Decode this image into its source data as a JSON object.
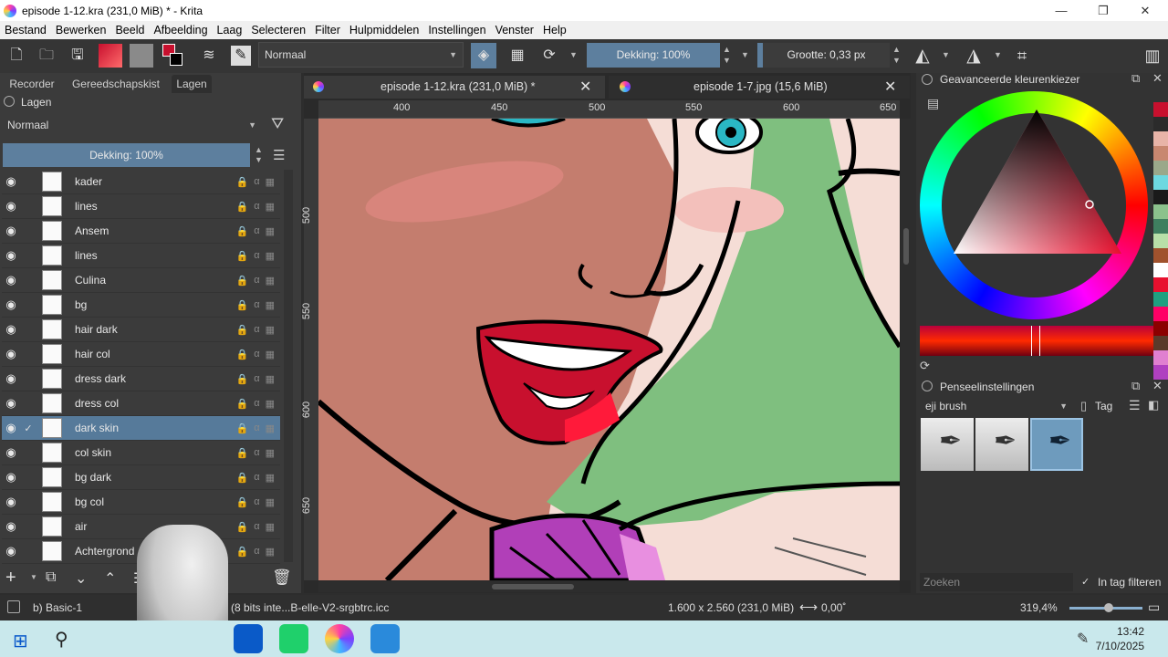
{
  "window": {
    "title": "episode 1-12.kra (231,0 MiB) * - Krita",
    "minimize": "—",
    "restore": "❐",
    "close": "✕"
  },
  "menu": [
    "Bestand",
    "Bewerken",
    "Beeld",
    "Afbeelding",
    "Laag",
    "Selecteren",
    "Filter",
    "Hulpmiddelen",
    "Instellingen",
    "Venster",
    "Help"
  ],
  "toolbar": {
    "blend_mode": "Normaal",
    "opacity": "Dekking: 100%",
    "size": "Grootte: 0,33 px"
  },
  "left_tabs": [
    "Recorder",
    "Gereedschapskist",
    "Lagen"
  ],
  "layers_panel": {
    "title": "Lagen",
    "blend_mode": "Normaal",
    "opacity": "Dekking: 100%",
    "layers": [
      {
        "name": "kader",
        "selected": false
      },
      {
        "name": "lines",
        "selected": false
      },
      {
        "name": "Ansem",
        "selected": false
      },
      {
        "name": "lines",
        "selected": false
      },
      {
        "name": "Culina",
        "selected": false
      },
      {
        "name": "bg",
        "selected": false
      },
      {
        "name": "hair dark",
        "selected": false
      },
      {
        "name": "hair col",
        "selected": false
      },
      {
        "name": "dress dark",
        "selected": false
      },
      {
        "name": "dress col",
        "selected": false
      },
      {
        "name": "dark skin",
        "selected": true
      },
      {
        "name": "col skin",
        "selected": false
      },
      {
        "name": "bg dark",
        "selected": false
      },
      {
        "name": "bg col",
        "selected": false
      },
      {
        "name": "air",
        "selected": false
      },
      {
        "name": "Achtergrond",
        "selected": false
      }
    ]
  },
  "doc_tabs": [
    {
      "label": "episode 1-12.kra (231,0 MiB) *",
      "close": "✕"
    },
    {
      "label": "episode 1-7.jpg (15,6 MiB)",
      "close": "✕"
    }
  ],
  "ruler": {
    "top": [
      "400",
      "450",
      "500",
      "550",
      "600",
      "650"
    ],
    "left": [
      "500",
      "550",
      "600",
      "650"
    ]
  },
  "color_panel": {
    "title": "Geavanceerde kleurenkiezer"
  },
  "brush_panel": {
    "title": "Penseelinstellingen",
    "preset": "eji brush",
    "tag": "Tag",
    "search_placeholder": "Zoeken",
    "filter_label": "In tag filteren"
  },
  "swatches": [
    "#c8102e",
    "#2b2b2b",
    "#e8b4a8",
    "#c88770",
    "#9aa88a",
    "#6dd8e0",
    "#1a1a1a",
    "#8bc28c",
    "#3f7f5f",
    "#b8e0a8",
    "#a0522d",
    "#ffffff",
    "#e8102e",
    "#20a080",
    "#f06",
    "#8b0000",
    "#5a3a2a",
    "#e080d0",
    "#b040c0"
  ],
  "status": {
    "brush": "b) Basic-1",
    "profile": "(8 bits inte...B-elle-V2-srgbtrc.icc",
    "dimensions": "1.600 x 2.560 (231,0 MiB)",
    "rotation": "0,00˚",
    "zoom": "319,4%"
  },
  "taskbar": {
    "time": "13:42",
    "date": "7/10/2025"
  }
}
